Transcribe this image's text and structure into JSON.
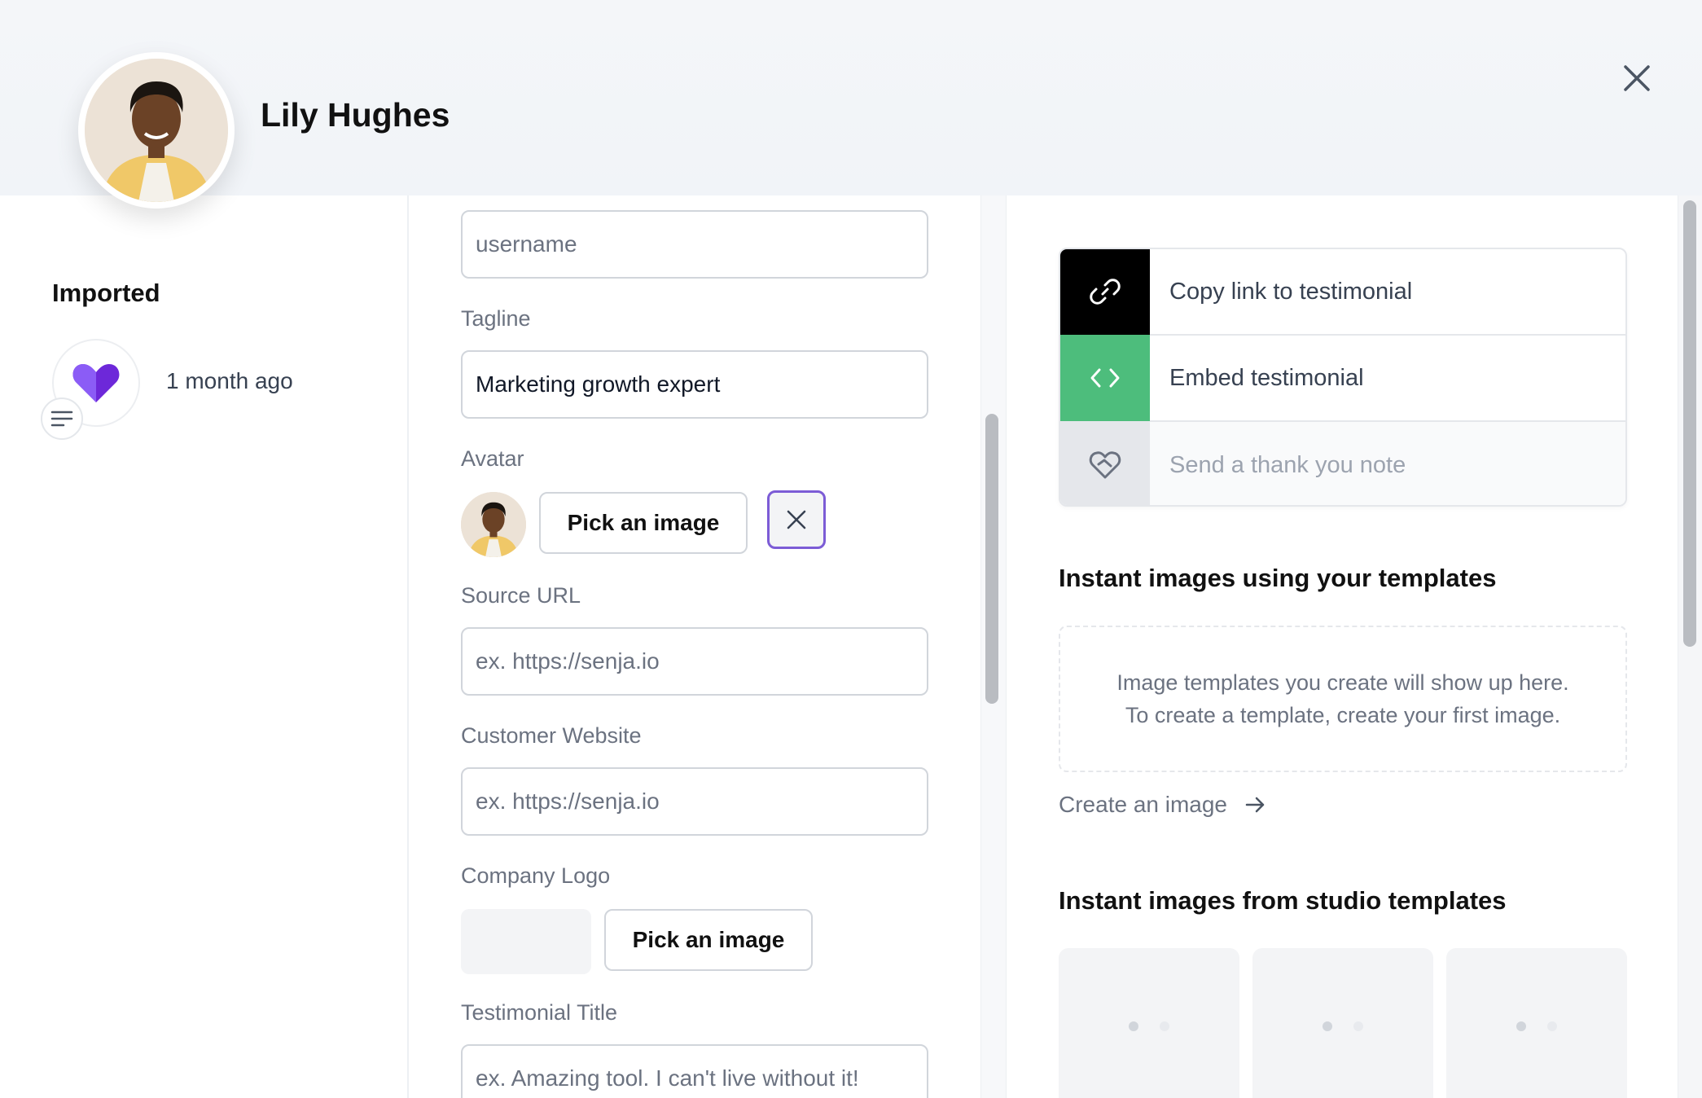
{
  "header": {
    "name": "Lily Hughes",
    "close_icon": "close-icon"
  },
  "activity": {
    "section_title": "Imported",
    "time": "1 month ago",
    "icon": "heart-icon",
    "badge_icon": "text-lines-icon"
  },
  "form": {
    "username": {
      "value": "",
      "placeholder": "username"
    },
    "tagline": {
      "label": "Tagline",
      "value": "Marketing growth expert",
      "placeholder": ""
    },
    "avatar": {
      "label": "Avatar",
      "pick_label": "Pick an image",
      "remove_icon": "close-icon"
    },
    "source_url": {
      "label": "Source URL",
      "value": "",
      "placeholder": "ex. https://senja.io"
    },
    "customer_website": {
      "label": "Customer Website",
      "value": "",
      "placeholder": "ex. https://senja.io"
    },
    "company_logo": {
      "label": "Company Logo",
      "pick_label": "Pick an image"
    },
    "testimonial_title": {
      "label": "Testimonial Title",
      "value": "",
      "placeholder": "ex. Amazing tool. I can't live without it!"
    }
  },
  "actions": [
    {
      "label": "Copy link to testimonial",
      "icon": "link-icon"
    },
    {
      "label": "Embed testimonial",
      "icon": "code-icon"
    },
    {
      "label": "Send a thank you note",
      "icon": "heart-handshake-icon"
    }
  ],
  "templates": {
    "heading": "Instant images using your templates",
    "empty_line1": "Image templates you create will show up here.",
    "empty_line2": "To create a template, create your first image.",
    "create_link": "Create an image"
  },
  "studio": {
    "heading": "Instant images from studio templates",
    "cards": 3
  },
  "colors": {
    "accent_purple": "#7c5cd6",
    "heart_purple": "#6d28d9",
    "embed_green": "#4dbd7c",
    "link_black": "#000000"
  }
}
